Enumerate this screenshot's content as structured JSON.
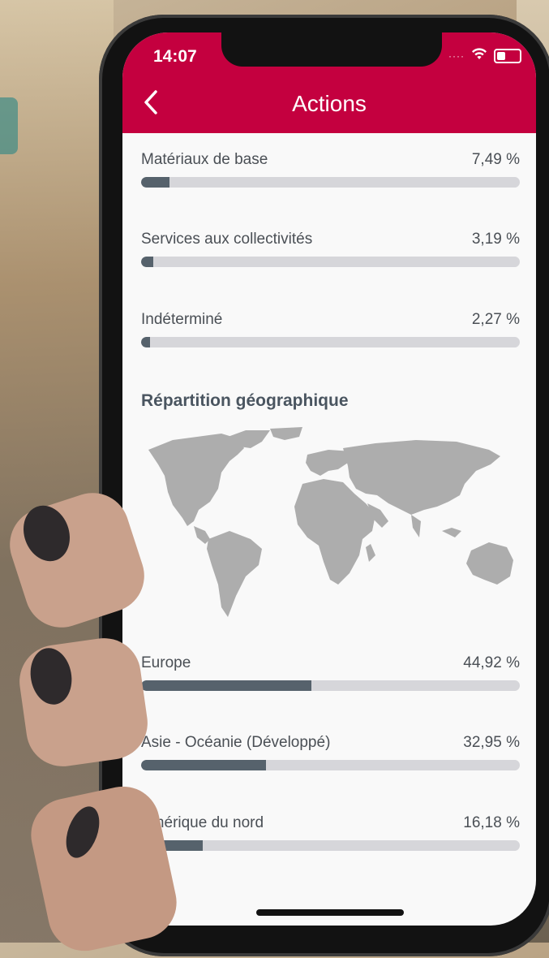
{
  "status_bar": {
    "time": "14:07"
  },
  "header": {
    "title": "Actions",
    "accent": "#c4003f"
  },
  "sector_rows": [
    {
      "label": "Matériaux de base",
      "value": "7,49 %",
      "fraction": 0.0749
    },
    {
      "label": "Services aux collectivités",
      "value": "3,19 %",
      "fraction": 0.0319
    },
    {
      "label": "Indéterminé",
      "value": "2,27 %",
      "fraction": 0.0227
    }
  ],
  "geo_section": {
    "title": "Répartition géographique"
  },
  "geo_rows": [
    {
      "label": "Europe",
      "value": "44,92 %",
      "fraction": 0.4492
    },
    {
      "label": "Asie - Océanie (Développé)",
      "value": "32,95 %",
      "fraction": 0.3295
    },
    {
      "label": "Amérique du nord",
      "value": "16,18 %",
      "fraction": 0.1618
    }
  ],
  "colors": {
    "bar_fill": "#56626c",
    "bar_track": "#d6d6da"
  }
}
